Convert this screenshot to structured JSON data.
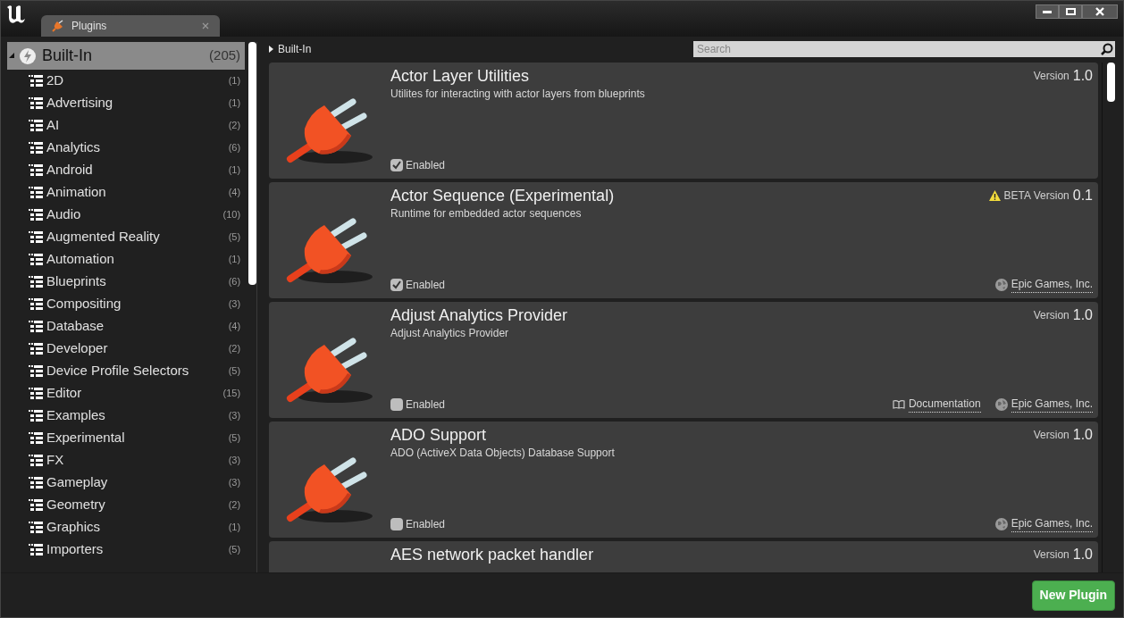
{
  "window": {
    "tab_title": "Plugins"
  },
  "tree": {
    "label": "Built-In",
    "count": "(205)",
    "expanded": true,
    "selected": true,
    "children": [
      {
        "label": "2D",
        "count": "(1)"
      },
      {
        "label": "Advertising",
        "count": "(1)"
      },
      {
        "label": "AI",
        "count": "(2)"
      },
      {
        "label": "Analytics",
        "count": "(6)"
      },
      {
        "label": "Android",
        "count": "(1)"
      },
      {
        "label": "Animation",
        "count": "(4)"
      },
      {
        "label": "Audio",
        "count": "(10)"
      },
      {
        "label": "Augmented Reality",
        "count": "(5)"
      },
      {
        "label": "Automation",
        "count": "(1)"
      },
      {
        "label": "Blueprints",
        "count": "(6)"
      },
      {
        "label": "Compositing",
        "count": "(3)"
      },
      {
        "label": "Database",
        "count": "(4)"
      },
      {
        "label": "Developer",
        "count": "(2)"
      },
      {
        "label": "Device Profile Selectors",
        "count": "(5)"
      },
      {
        "label": "Editor",
        "count": "(15)"
      },
      {
        "label": "Examples",
        "count": "(3)"
      },
      {
        "label": "Experimental",
        "count": "(5)"
      },
      {
        "label": "FX",
        "count": "(3)"
      },
      {
        "label": "Gameplay",
        "count": "(3)"
      },
      {
        "label": "Geometry",
        "count": "(2)"
      },
      {
        "label": "Graphics",
        "count": "(1)"
      },
      {
        "label": "Importers",
        "count": "(5)"
      }
    ]
  },
  "breadcrumb": "Built-In",
  "search": {
    "placeholder": "Search"
  },
  "plugins": [
    {
      "title": "Actor Layer Utilities",
      "description": "Utilites for interacting with actor layers from blueprints",
      "beta": false,
      "version_label": "Version",
      "version": "1.0",
      "enabled": true,
      "enabled_label": "Enabled"
    },
    {
      "title": "Actor Sequence (Experimental)",
      "description": "Runtime for embedded actor sequences",
      "beta": true,
      "version_label": "BETA Version",
      "version": "0.1",
      "enabled": true,
      "enabled_label": "Enabled",
      "vendor": "Epic Games, Inc."
    },
    {
      "title": "Adjust Analytics Provider",
      "description": "Adjust Analytics Provider",
      "beta": false,
      "version_label": "Version",
      "version": "1.0",
      "enabled": false,
      "enabled_label": "Enabled",
      "documentation": "Documentation",
      "vendor": "Epic Games, Inc."
    },
    {
      "title": "ADO Support",
      "description": "ADO (ActiveX Data Objects) Database Support",
      "beta": false,
      "version_label": "Version",
      "version": "1.0",
      "enabled": false,
      "enabled_label": "Enabled",
      "vendor": "Epic Games, Inc."
    },
    {
      "title": "AES network packet handler",
      "beta": false,
      "version_label": "Version",
      "version": "1.0"
    }
  ],
  "new_plugin_button": "New Plugin"
}
